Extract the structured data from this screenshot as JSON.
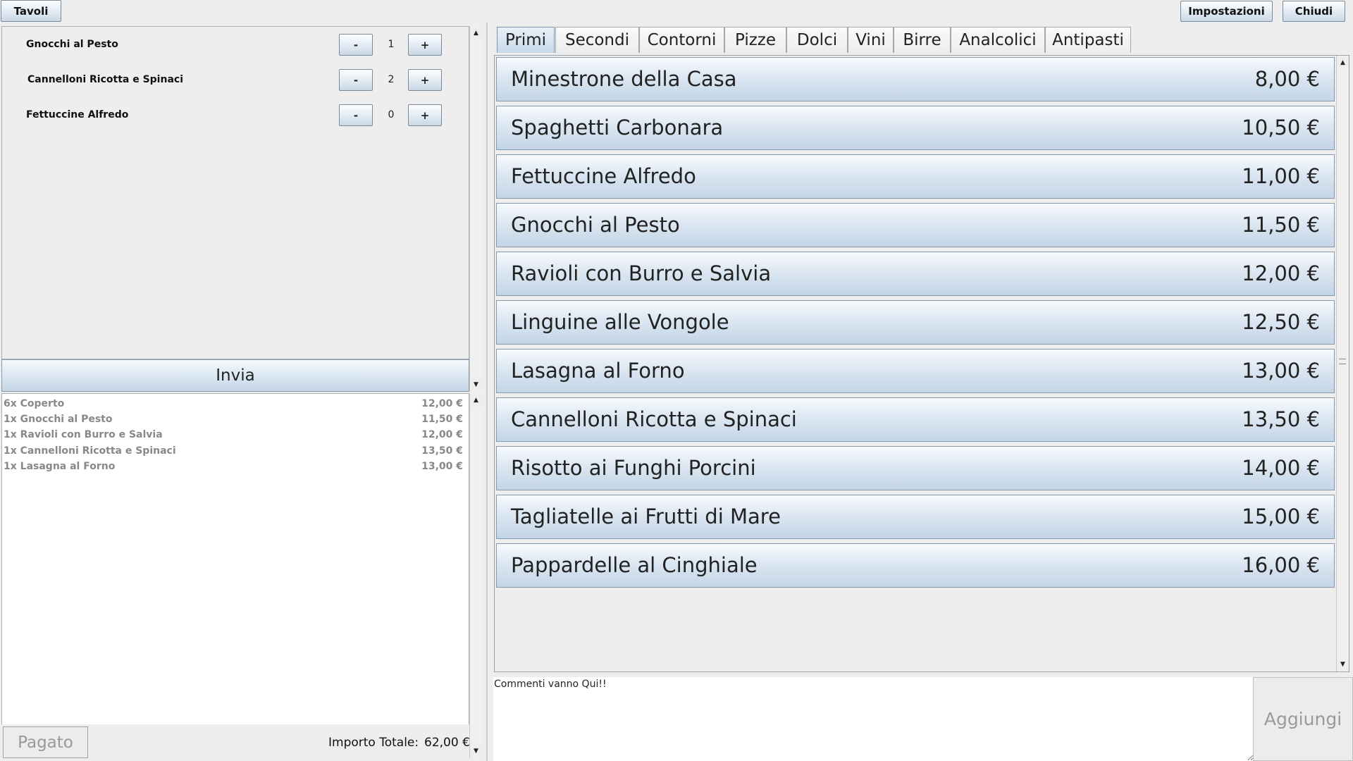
{
  "toolbar": {
    "tavoli_label": "Tavoli",
    "impostazioni_label": "Impostazioni",
    "chiudi_label": "Chiudi"
  },
  "compose": {
    "items": [
      {
        "name": "Gnocchi al Pesto",
        "qty": "1"
      },
      {
        "name": "Cannelloni Ricotta e Spinaci",
        "qty": "2"
      },
      {
        "name": "Fettuccine Alfredo",
        "qty": "0"
      }
    ],
    "minus_label": "-",
    "plus_label": "+",
    "send_label": "Invia"
  },
  "summary": {
    "lines": [
      {
        "desc": "6x Coperto",
        "price": "12,00 €"
      },
      {
        "desc": "1x Gnocchi al Pesto",
        "price": "11,50 €"
      },
      {
        "desc": "1x Ravioli con Burro e Salvia",
        "price": "12,00 €"
      },
      {
        "desc": "1x Cannelloni Ricotta e Spinaci",
        "price": "13,50 €"
      },
      {
        "desc": "1x Lasagna al Forno",
        "price": "13,00 €"
      }
    ],
    "paid_label": "Pagato",
    "total_label": "Importo Totale:",
    "total_value": "62,00 €"
  },
  "tabs": [
    "Primi",
    "Secondi",
    "Contorni",
    "Pizze",
    "Dolci",
    "Vini",
    "Birre",
    "Analcolici",
    "Antipasti"
  ],
  "active_tab": "Primi",
  "menu": {
    "items": [
      {
        "name": "Minestrone della Casa",
        "price": "8,00 €"
      },
      {
        "name": "Spaghetti Carbonara",
        "price": "10,50 €"
      },
      {
        "name": "Fettuccine Alfredo",
        "price": "11,00 €"
      },
      {
        "name": "Gnocchi al Pesto",
        "price": "11,50 €"
      },
      {
        "name": "Ravioli con Burro e Salvia",
        "price": "12,00 €"
      },
      {
        "name": "Linguine alle Vongole",
        "price": "12,50 €"
      },
      {
        "name": "Lasagna al Forno",
        "price": "13,00 €"
      },
      {
        "name": "Cannelloni Ricotta e Spinaci",
        "price": "13,50 €"
      },
      {
        "name": "Risotto ai Funghi Porcini",
        "price": "14,00 €"
      },
      {
        "name": "Tagliatelle ai Frutti di Mare",
        "price": "15,00 €"
      },
      {
        "name": "Pappardelle al Cinghiale",
        "price": "16,00 €"
      }
    ]
  },
  "comment": {
    "value": "Commenti vanno Qui!!"
  },
  "add_label": "Aggiungi",
  "icons": {
    "scroll_up": "arrow-up-icon",
    "scroll_down": "arrow-down-icon"
  }
}
